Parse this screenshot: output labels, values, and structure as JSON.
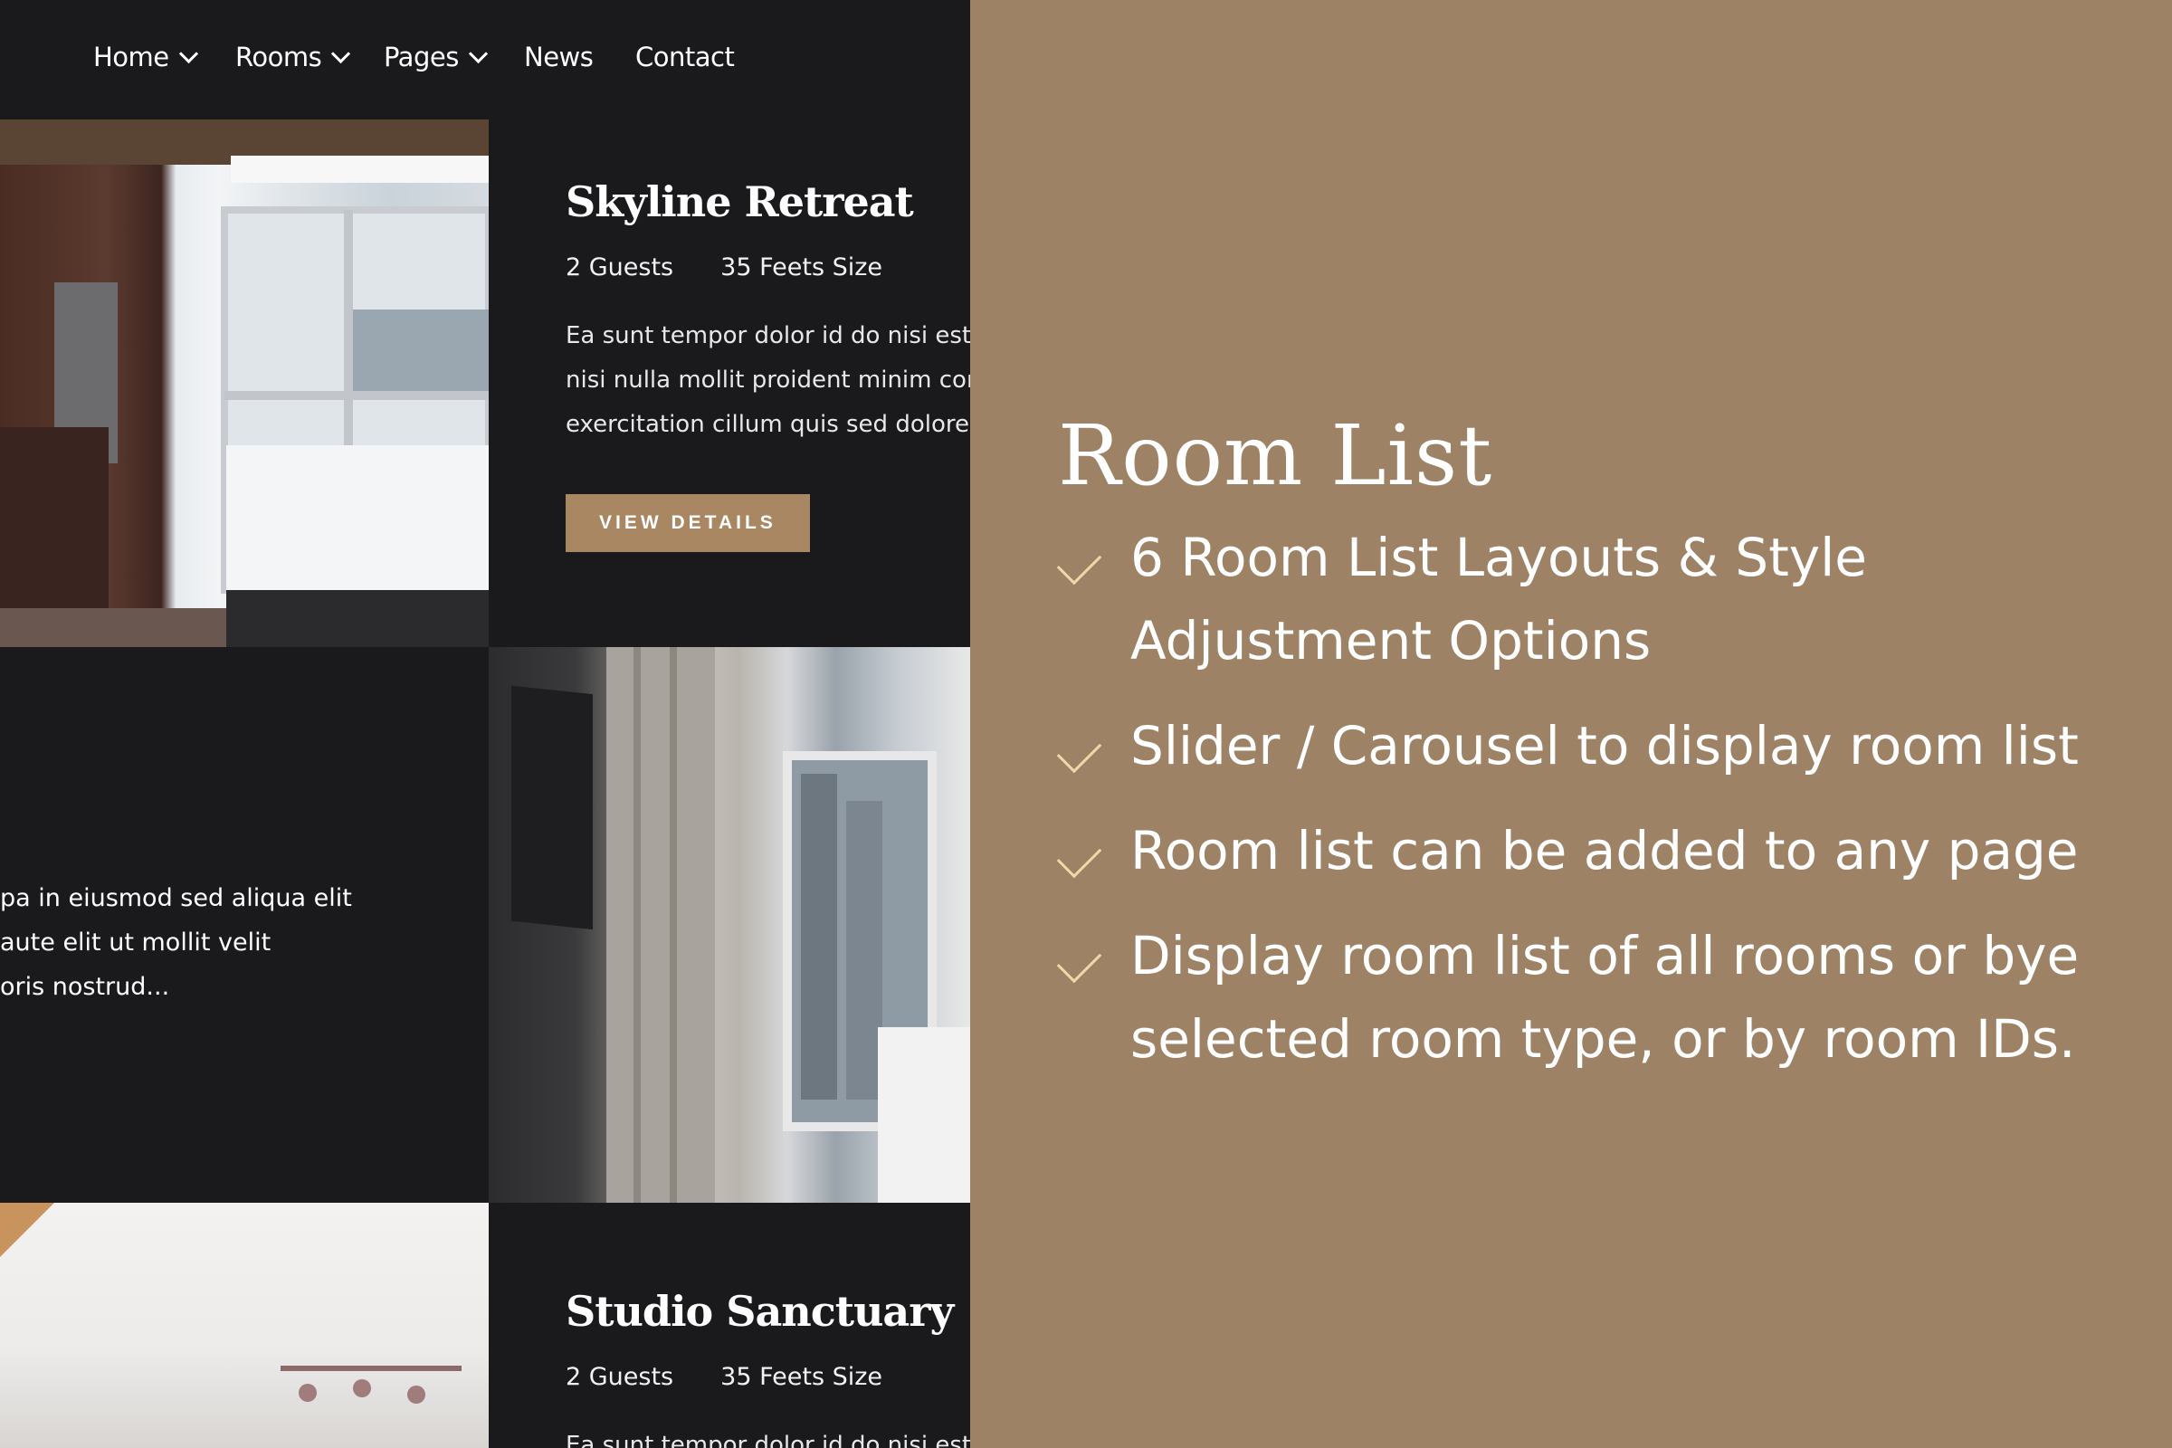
{
  "nav": {
    "items": [
      {
        "label": "Home",
        "dropdown": true
      },
      {
        "label": "Rooms",
        "dropdown": true
      },
      {
        "label": "Pages",
        "dropdown": true
      },
      {
        "label": "News",
        "dropdown": false
      },
      {
        "label": "Contact",
        "dropdown": false
      }
    ]
  },
  "rooms": [
    {
      "title": "Skyline Retreat",
      "guests": "2 Guests",
      "size": "35 Feets Size",
      "desc_lines": [
        "Ea sunt tempor dolor id do nisi est s",
        "nisi nulla mollit proident minim comr",
        "exercitation cillum quis sed dolore q"
      ],
      "button": "VIEW DETAILS"
    },
    {
      "desc_lines": [
        "pa in eiusmod sed aliqua elit",
        "aute elit ut mollit velit",
        "oris nostrud..."
      ]
    },
    {
      "title": "Studio Sanctuary",
      "guests": "2 Guests",
      "size": "35 Feets Size",
      "desc_lines": [
        "Ea sunt tempor dolor id do nisi est s"
      ]
    }
  ],
  "panel": {
    "heading": "Room List",
    "features": [
      "6 Room List Layouts & Style Adjustment Options",
      "Slider / Carousel to display room list",
      "Room list can be added to any page",
      "Display room list of all rooms or bye selected room type, or by room IDs."
    ]
  },
  "colors": {
    "accent": "#a98763",
    "panel": "#9d8265",
    "dark": "#1a1a1c",
    "check": "#f0d9a8"
  }
}
